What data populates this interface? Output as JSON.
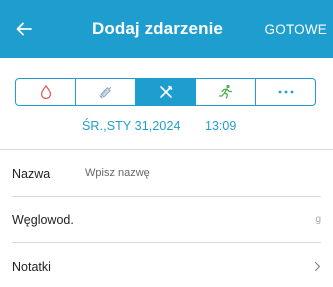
{
  "header": {
    "title": "Dodaj zdarzenie",
    "done_label": "GOTOWE",
    "background_color": "#1e9ecf"
  },
  "event_types": [
    {
      "icon": "blood-drop-icon",
      "color": "#e05a5a",
      "active": false
    },
    {
      "icon": "syringe-icon",
      "color": "#8fa8b8",
      "active": false
    },
    {
      "icon": "fork-knife-icon",
      "color": "#ffffff",
      "active": true
    },
    {
      "icon": "runner-icon",
      "color": "#4caf50",
      "active": false
    },
    {
      "icon": "more-icon",
      "color": "#1e9ecf",
      "active": false
    }
  ],
  "datetime": {
    "date": "ŚR.,STY 31,2024",
    "time": "13:09"
  },
  "form": {
    "name_label": "Nazwa",
    "name_placeholder": "Wpisz nazwę",
    "carbs_label": "Węglowod.",
    "carbs_unit": "g",
    "notes_label": "Notatki"
  }
}
